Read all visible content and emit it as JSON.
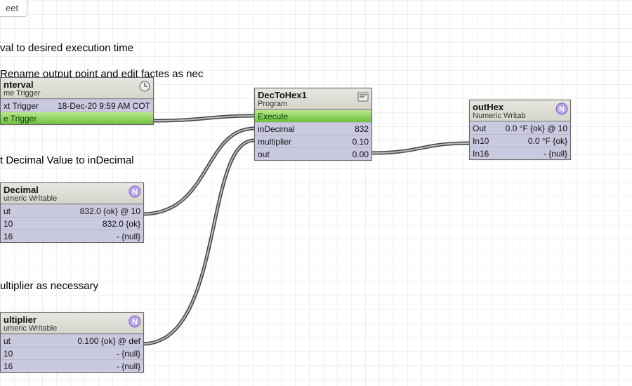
{
  "tab_label": "eet",
  "text_interval_header": "val to desired execution time",
  "text_decimal_header": "t Decimal Value to inDecimal",
  "text_multiplier_header": "ultiplier as necessary",
  "text_output_header": "Rename output point and edit factes as nec",
  "node_interval": {
    "title": "nterval",
    "subtitle": "me Trigger",
    "row1_label": "xt Trigger",
    "row1_value": "18-Dec-20 9:59 AM COT",
    "row2_label": "e Trigger",
    "row2_value": ""
  },
  "node_decimal": {
    "title": "Decimal",
    "subtitle": "umeric Writable",
    "row1_label": "ut",
    "row1_value": "832.0 {ok} @ 10",
    "row2_label": "10",
    "row2_value": "832.0 {ok}",
    "row3_label": "16",
    "row3_value": "- {null}"
  },
  "node_multiplier": {
    "title": "ultiplier",
    "subtitle": "umeric Writable",
    "row1_label": "ut",
    "row1_value": "0.100 {ok} @ def",
    "row2_label": "10",
    "row2_value": "- {null}",
    "row3_label": "16",
    "row3_value": "- {null}"
  },
  "node_dectohex": {
    "title": "DecToHex1",
    "subtitle": "Program",
    "row_exec": "Execute",
    "row1_label": "inDecimal",
    "row1_value": "832",
    "row2_label": "multiplier",
    "row2_value": "0.10",
    "row3_label": "out",
    "row3_value": "0.00"
  },
  "node_outhex": {
    "title": "outHex",
    "subtitle": "Numeric Writab",
    "row1_label": "Out",
    "row1_value": "0.0 °F {ok} @ 10",
    "row2_label": "In10",
    "row2_value": "0.0 °F {ok}",
    "row3_label": "In16",
    "row3_value": "- {null}"
  }
}
